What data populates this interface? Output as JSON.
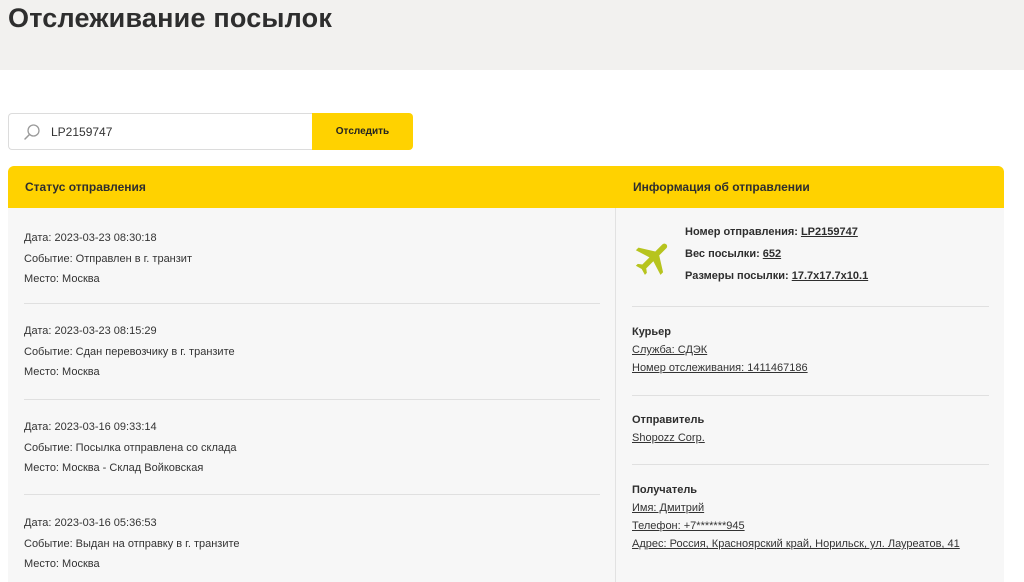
{
  "page": {
    "title": "Отслеживание посылок"
  },
  "search": {
    "value": "LP2159747",
    "button_label": "Отследить"
  },
  "panel": {
    "status_title": "Статус отправления",
    "info_title": "Информация об отправлении"
  },
  "events": [
    {
      "date": "Дата: 2023-03-23 08:30:18",
      "event": "Событие: Отправлен в г. транзит",
      "place": "Место: Москва"
    },
    {
      "date": "Дата: 2023-03-23 08:15:29",
      "event": "Событие: Сдан перевозчику в г. транзите",
      "place": "Место: Москва"
    },
    {
      "date": "Дата: 2023-03-16 09:33:14",
      "event": "Событие: Посылка отправлена со склада",
      "place": "Место: Москва - Склад Войковская"
    },
    {
      "date": "Дата: 2023-03-16 05:36:53",
      "event": "Событие: Выдан на отправку в г. транзите",
      "place": "Место: Москва"
    }
  ],
  "shipment": {
    "icon": "airplane-icon",
    "number_label": "Номер отправления:",
    "number_value": "LP2159747",
    "weight_label": "Вес посылки:",
    "weight_value": "652",
    "size_label": "Размеры посылки:",
    "size_value": "17.7x17.7x10.1"
  },
  "courier": {
    "title": "Курьер",
    "service": "Служба: СДЭК",
    "tracking": "Номер отслеживания: 1411467186"
  },
  "sender": {
    "title": "Отправитель",
    "name": "Shopozz Corp."
  },
  "recipient": {
    "title": "Получатель",
    "name": "Имя: Дмитрий",
    "phone": "Телефон: +7*******945",
    "address": "Адрес: Россия, Красноярский край, Норильск, ул. Лауреатов, 41"
  },
  "colors": {
    "accent": "#ffd200",
    "plane": "#b7c41e",
    "header_bg": "#f2f1ef",
    "panel_bg": "#f7f7f7"
  }
}
